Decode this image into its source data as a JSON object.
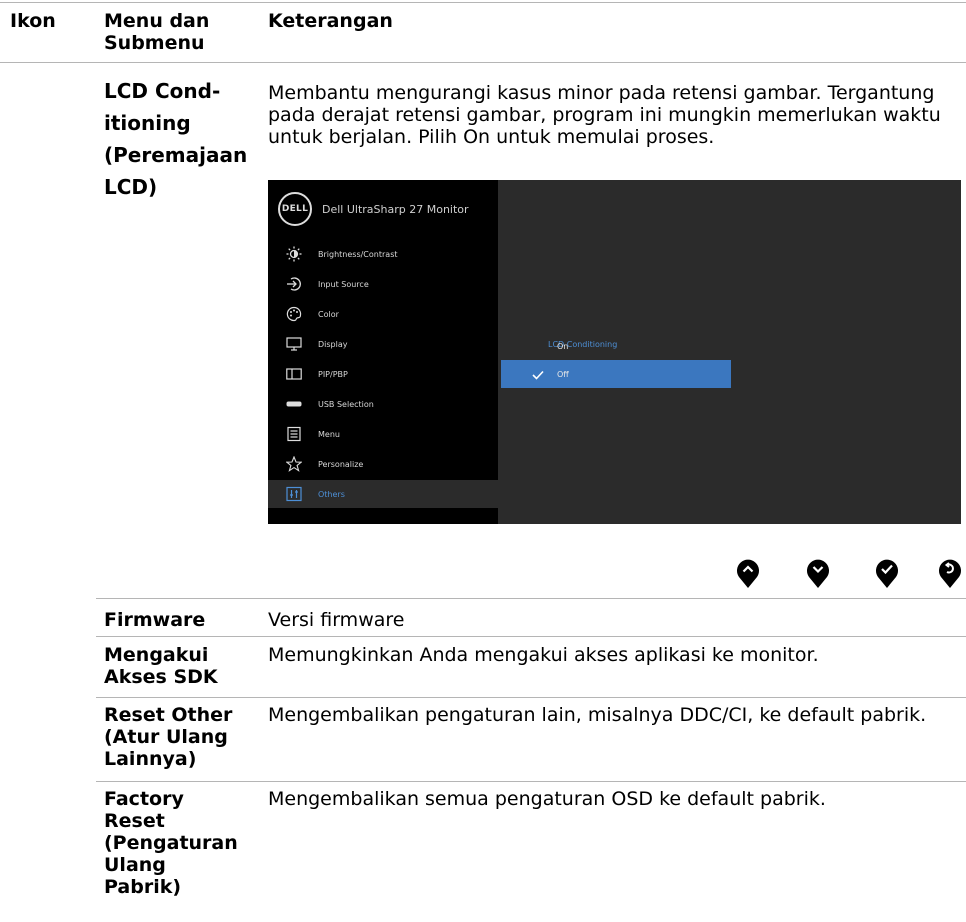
{
  "table": {
    "headers": {
      "icon": "Ikon",
      "menu": "Menu dan Submenu",
      "desc": "Keterangan"
    },
    "lcd": {
      "term": "LCD Cond-itioning (Peremajaan LCD)",
      "desc": "Membantu mengurangi kasus minor pada retensi gambar. Tergantung pada derajat retensi gambar, program ini mungkin memerlukan waktu untuk berjalan. Pilih On untuk memulai proses."
    },
    "rows": [
      {
        "term": "Firmware",
        "desc": "Versi firmware"
      },
      {
        "term": "Mengakui Akses SDK",
        "desc": "Memungkinkan Anda mengakui akses aplikasi ke monitor."
      },
      {
        "term": "Reset Other (Atur Ulang Lainnya)",
        "desc": "Mengembalikan pengaturan lain, misalnya DDC/CI, ke default pabrik."
      },
      {
        "term": "Factory Reset (Pengaturan Ulang Pabrik)",
        "desc": "Mengembalikan semua pengaturan OSD ke default pabrik."
      }
    ]
  },
  "osd": {
    "logo": "DELL",
    "title": "Dell UltraSharp 27 Monitor",
    "menu": [
      {
        "label": "Brightness/Contrast",
        "icon": "brightness-icon"
      },
      {
        "label": "Input Source",
        "icon": "input-source-icon"
      },
      {
        "label": "Color",
        "icon": "color-palette-icon"
      },
      {
        "label": "Display",
        "icon": "display-monitor-icon"
      },
      {
        "label": "PIP/PBP",
        "icon": "pip-pbp-icon"
      },
      {
        "label": "USB Selection",
        "icon": "usb-icon"
      },
      {
        "label": "Menu",
        "icon": "menu-list-icon"
      },
      {
        "label": "Personalize",
        "icon": "star-icon"
      },
      {
        "label": "Others",
        "icon": "others-icon",
        "active": true
      }
    ],
    "submenu_label": "LCD Conditioning",
    "options": [
      {
        "label": "On",
        "selected": false
      },
      {
        "label": "Off",
        "selected": true
      }
    ],
    "accent_color": "#3b77bf",
    "highlight_text_color": "#4d8fd6"
  },
  "nav_buttons": [
    "up-button-icon",
    "down-button-icon",
    "check-button-icon",
    "back-button-icon"
  ]
}
